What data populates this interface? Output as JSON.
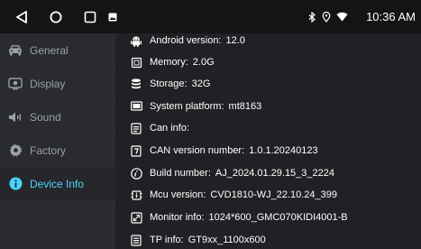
{
  "status_bar": {
    "time": "10:36 AM",
    "icons": [
      "back-icon",
      "home-icon",
      "recents-icon",
      "image-notification-icon",
      "bluetooth-icon",
      "location-icon",
      "wifi-icon"
    ]
  },
  "sidebar": {
    "items": [
      {
        "label": "General",
        "icon": "car-icon"
      },
      {
        "label": "Display",
        "icon": "display-icon"
      },
      {
        "label": "Sound",
        "icon": "speaker-icon"
      },
      {
        "label": "Factory",
        "icon": "gear-icon"
      },
      {
        "label": "Device Info",
        "icon": "info-icon",
        "active": true
      }
    ]
  },
  "info": [
    {
      "label": "Android version:",
      "value": "12.0",
      "icon": "android-icon"
    },
    {
      "label": "Memory:",
      "value": "2.0G",
      "icon": "memory-chip-icon"
    },
    {
      "label": "Storage:",
      "value": "32G",
      "icon": "storage-icon"
    },
    {
      "label": "System platform:",
      "value": "mt8163",
      "icon": "platform-icon"
    },
    {
      "label": "Can info:",
      "value": "",
      "icon": "can-info-icon"
    },
    {
      "label": "CAN version number:",
      "value": "1.0.1.20240123",
      "icon": "can-version-icon"
    },
    {
      "label": "Build number:",
      "value": "AJ_2024.01.29.15_3_2224",
      "icon": "build-icon"
    },
    {
      "label": "Mcu version:",
      "value": "CVD1810-WJ_22.10.24_399",
      "icon": "mcu-icon"
    },
    {
      "label": "Monitor info:",
      "value": "1024*600_GMC070KIDI4001-B",
      "icon": "monitor-icon"
    },
    {
      "label": "TP info:",
      "value": "GT9xx_1100x600",
      "icon": "tp-icon"
    }
  ],
  "colors": {
    "accent": "#4cd2ff",
    "sidebar_bg": "#2a2b2e",
    "content_bg": "#202124",
    "status_bg": "#141414"
  }
}
